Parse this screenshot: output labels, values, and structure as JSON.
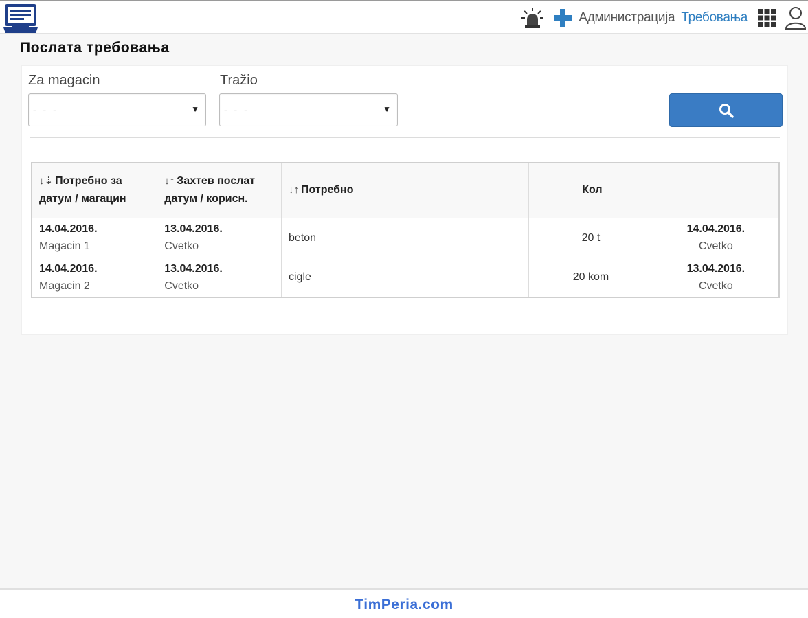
{
  "header": {
    "nav_admin": "Администрација",
    "nav_requests": "Требовања",
    "icons": [
      "app-logo-icon",
      "alarm-siren-icon",
      "plus-icon",
      "apps-grid-icon",
      "user-icon"
    ],
    "accent_color": "#2f7fc1"
  },
  "page": {
    "title": "Послата требовања"
  },
  "filters": {
    "warehouse_label": "Za magacin",
    "warehouse_value": "- - -",
    "requester_label": "Tražio",
    "requester_value": "- - -",
    "search_button_icon": "search-icon",
    "button_color": "#3a7cc4"
  },
  "table": {
    "columns": [
      {
        "sort_icon": "↓⇣",
        "line1": "Потребно за",
        "line2": "датум / магацин"
      },
      {
        "sort_icon": "↓↑",
        "line1": "Захтев послат",
        "line2": "датум / корисн."
      },
      {
        "sort_icon": "↓↑",
        "line1": "Потребно",
        "line2": ""
      },
      {
        "sort_icon": "",
        "line1": "Кол",
        "line2": ""
      },
      {
        "sort_icon": "",
        "line1": "",
        "line2": ""
      }
    ],
    "rows": [
      {
        "needed_date": "14.04.2016.",
        "warehouse": "Magacin 1",
        "sent_date": "13.04.2016.",
        "sent_user": "Cvetko",
        "item": "beton",
        "qty": "20 t",
        "last_date": "14.04.2016.",
        "last_user": "Cvetko"
      },
      {
        "needed_date": "14.04.2016.",
        "warehouse": "Magacin 2",
        "sent_date": "13.04.2016.",
        "sent_user": "Cvetko",
        "item": "cigle",
        "qty": "20 kom",
        "last_date": "13.04.2016.",
        "last_user": "Cvetko"
      }
    ]
  },
  "footer": {
    "link": "TimPeria.com",
    "color": "#3b6fd6"
  }
}
